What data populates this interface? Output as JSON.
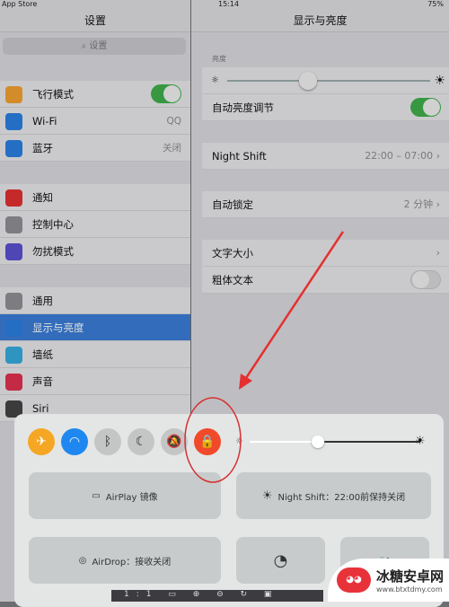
{
  "status": {
    "carrier": "App Store",
    "time": "15:14",
    "battery": "75%"
  },
  "left": {
    "title": "设置",
    "search_placeholder": "设置",
    "items": [
      {
        "label": "飞行模式",
        "icon": "airplane-icon",
        "color": "#f0a030",
        "toggle": true
      },
      {
        "label": "Wi-Fi",
        "icon": "wifi-icon",
        "color": "#2a7ee0",
        "value": "QQ"
      },
      {
        "label": "蓝牙",
        "icon": "bluetooth-icon",
        "color": "#2a7ee0",
        "value": "关闭"
      },
      {
        "label": "通知",
        "icon": "notifications-icon",
        "color": "#e03030"
      },
      {
        "label": "控制中心",
        "icon": "control-center-icon",
        "color": "#8e8e93"
      },
      {
        "label": "勿扰模式",
        "icon": "moon-icon",
        "color": "#5a4fcf"
      },
      {
        "label": "通用",
        "icon": "gear-icon",
        "color": "#8e8e93"
      },
      {
        "label": "显示与亮度",
        "icon": "display-icon",
        "color": "#2a7ee0",
        "selected": true
      },
      {
        "label": "墙纸",
        "icon": "wallpaper-icon",
        "color": "#35aadc"
      },
      {
        "label": "声音",
        "icon": "sound-icon",
        "color": "#e03050"
      },
      {
        "label": "Siri",
        "icon": "siri-icon",
        "color": "#444"
      }
    ]
  },
  "right": {
    "title": "显示与亮度",
    "brightness_label": "亮度",
    "brightness_level": 0.4,
    "auto_brightness": "自动亮度调节",
    "night_shift": "Night Shift",
    "night_shift_value": "22:00 – 07:00",
    "auto_lock": "自动锁定",
    "auto_lock_value": "2 分钟",
    "text_size": "文字大小",
    "bold_text": "粗体文本"
  },
  "control_center": {
    "buttons": [
      {
        "name": "airplane-mode",
        "icon": "airplane-icon",
        "color": "#f5a623",
        "glyph": "✈"
      },
      {
        "name": "wifi",
        "icon": "wifi-icon",
        "color": "#1e88f0",
        "glyph": "◠"
      },
      {
        "name": "bluetooth",
        "icon": "bluetooth-icon",
        "color": "#c4c6c6",
        "glyph": "ᛒ"
      },
      {
        "name": "do-not-disturb",
        "icon": "moon-icon",
        "color": "#c4c6c6",
        "glyph": "☾"
      },
      {
        "name": "mute",
        "icon": "bell-slash-icon",
        "color": "#c4c6c6",
        "glyph": "🔕"
      },
      {
        "name": "rotation-lock",
        "icon": "rotation-lock-icon",
        "color": "#f04a2a",
        "glyph": "🔒"
      }
    ],
    "brightness_level": 0.4,
    "airplay": "AirPlay 镜像",
    "night_shift": "Night Shift：22:00前保持关闭",
    "airdrop": "AirDrop：接收关闭"
  },
  "toolbar": {
    "text": "1:1"
  },
  "watermark": {
    "name": "冰糖安卓网",
    "url": "www.btxtdmy.com"
  }
}
